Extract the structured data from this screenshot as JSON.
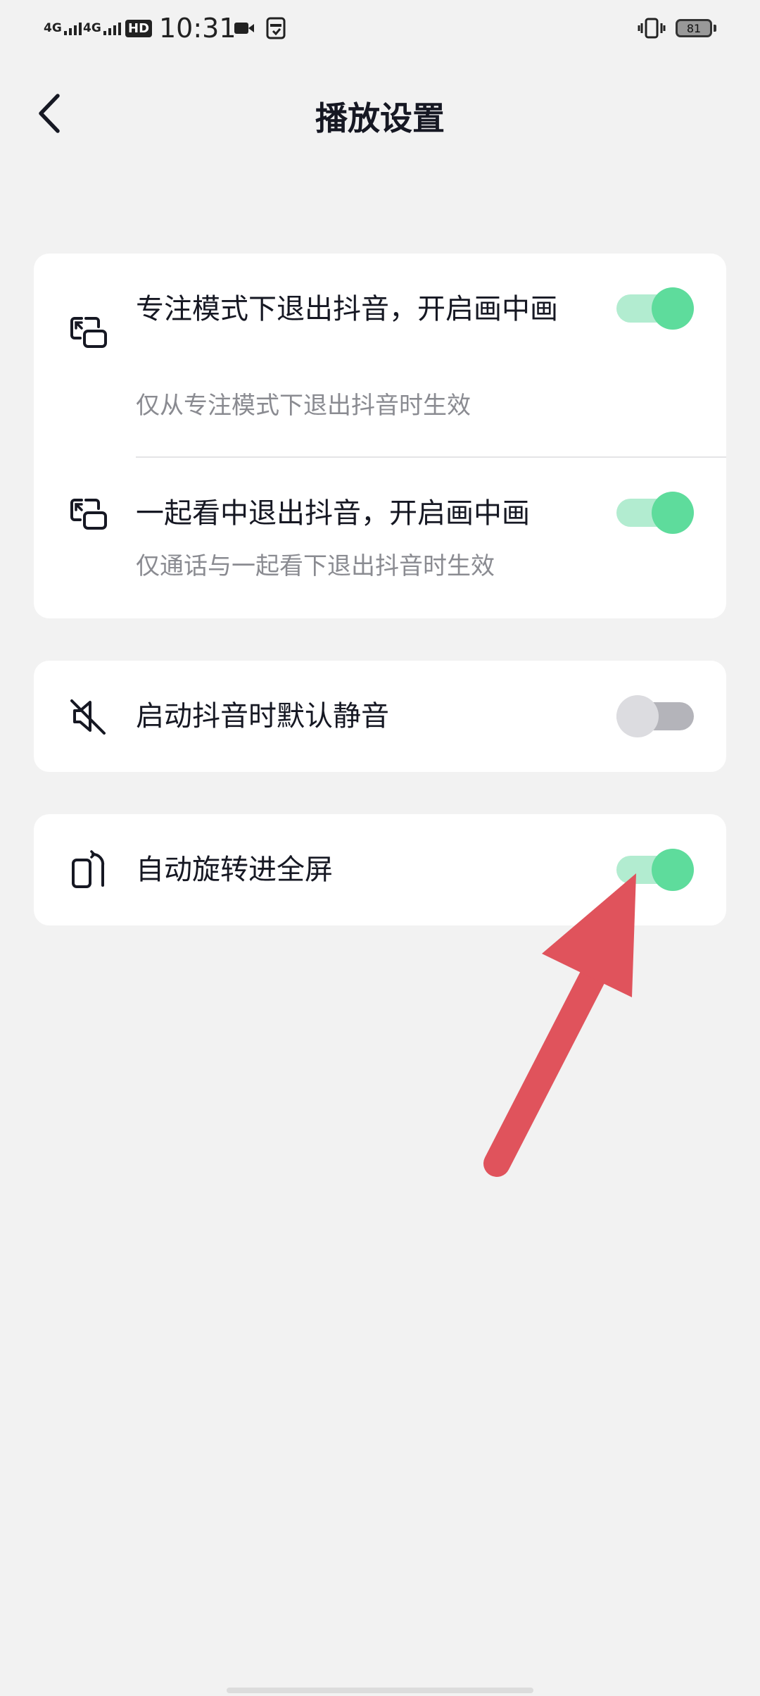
{
  "status_bar": {
    "net1": "4G",
    "net2": "4G",
    "hd": "HD",
    "time": "10:31",
    "battery": "81"
  },
  "header": {
    "title": "播放设置",
    "back_icon": "chevron-left-icon"
  },
  "sections": [
    {
      "rows": [
        {
          "icon": "picture-in-picture-icon",
          "title": "专注模式下退出抖音，开启画中画",
          "subtitle": "仅从专注模式下退出抖音时生效",
          "enabled": true
        },
        {
          "icon": "picture-in-picture-icon",
          "title": "一起看中退出抖音，开启画中画",
          "subtitle": "仅通话与一起看下退出抖音时生效",
          "enabled": true
        }
      ]
    },
    {
      "rows": [
        {
          "icon": "mute-icon",
          "title": "启动抖音时默认静音",
          "enabled": false
        }
      ]
    },
    {
      "rows": [
        {
          "icon": "rotate-icon",
          "title": "自动旋转进全屏",
          "enabled": true
        }
      ]
    }
  ],
  "colors": {
    "background": "#f2f2f2",
    "card": "#ffffff",
    "toggle_on_knob": "#5edc9c",
    "toggle_on_track": "#b2ecd0",
    "toggle_off_knob": "#dcdce0",
    "toggle_off_track": "#b4b4ba",
    "annotation_arrow": "#e0535c"
  }
}
